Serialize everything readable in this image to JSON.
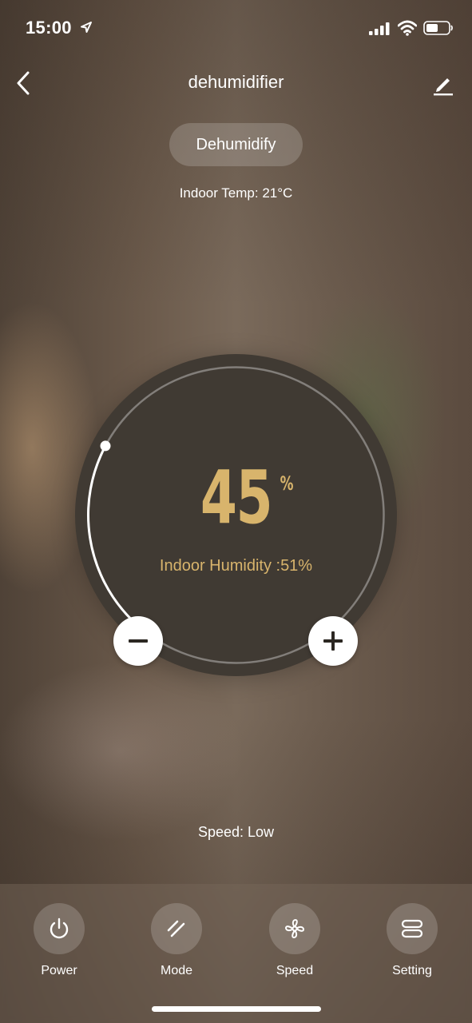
{
  "status_bar": {
    "time": "15:00",
    "icons": [
      "location-arrow-icon",
      "cellular-signal-icon",
      "wifi-icon",
      "battery-icon"
    ]
  },
  "header": {
    "title": "dehumidifier",
    "back_icon": "chevron-left-icon",
    "edit_icon": "pencil-icon"
  },
  "mode": {
    "label": "Dehumidify"
  },
  "indoor_temp": "Indoor Temp: 21°C",
  "dial": {
    "target_value": "45",
    "unit": "%",
    "indoor_humidity": "Indoor Humidity :51%",
    "level_fraction": 0.45,
    "minus_icon": "minus-icon",
    "plus_icon": "plus-icon"
  },
  "speed_status": "Speed: Low",
  "bottom_bar": {
    "items": [
      {
        "label": "Power",
        "icon": "power-icon"
      },
      {
        "label": "Mode",
        "icon": "mode-icon"
      },
      {
        "label": "Speed",
        "icon": "fan-icon"
      },
      {
        "label": "Setting",
        "icon": "settings-icon"
      }
    ]
  },
  "colors": {
    "accent": "#d8b46c",
    "dial_background": "#403a33"
  }
}
